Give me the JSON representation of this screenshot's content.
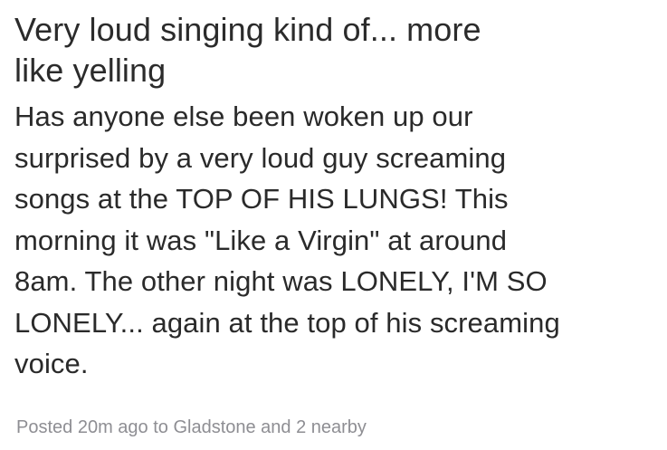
{
  "post": {
    "title_lines": [
      "Very loud singing kind of... more",
      "like yelling"
    ],
    "body_lines": [
      "Has anyone else been woken up our",
      "surprised by a very loud guy screaming",
      "songs at the TOP  OF HIS LUNGS! This",
      "morning it was \"Like a Virgin\" at around",
      "8am. The other night was LONELY, I'M SO",
      "LONELY... again at the top of his screaming",
      "voice."
    ],
    "meta": "Posted 20m ago to Gladstone and 2 nearby"
  }
}
